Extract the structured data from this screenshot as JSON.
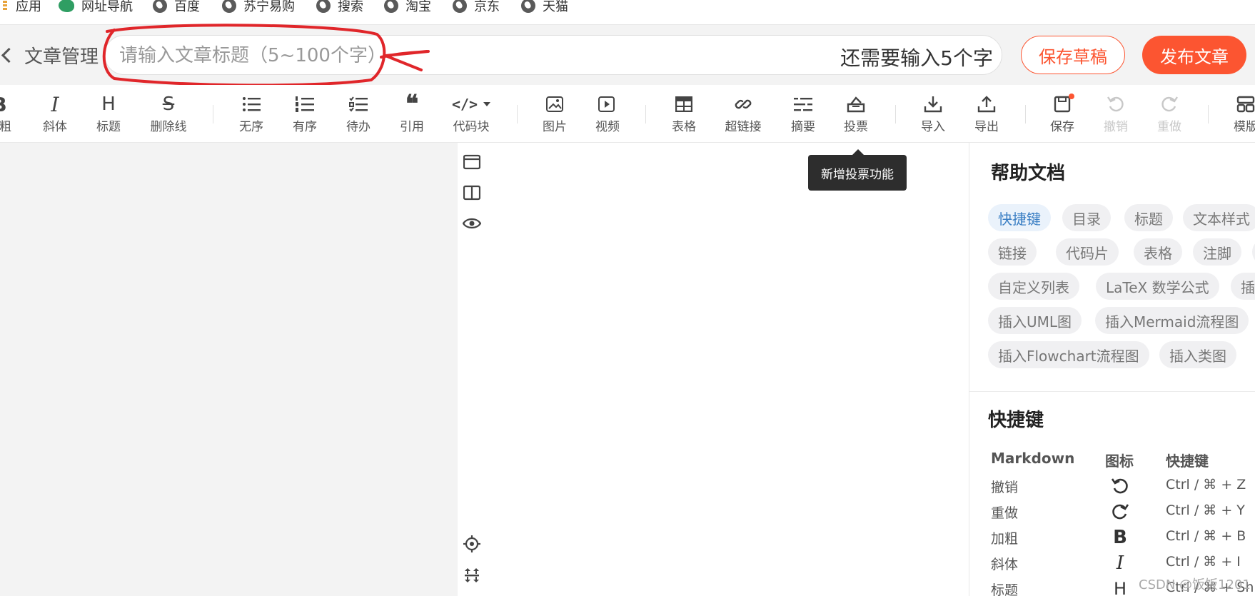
{
  "bookmarks": [
    {
      "label": "应用",
      "icon": "apps-icon"
    },
    {
      "label": "网址导航",
      "icon": "leaf-icon"
    },
    {
      "label": "百度",
      "icon": "globe-icon"
    },
    {
      "label": "苏宁易购",
      "icon": "globe-icon"
    },
    {
      "label": "搜索",
      "icon": "globe-icon"
    },
    {
      "label": "淘宝",
      "icon": "globe-icon"
    },
    {
      "label": "京东",
      "icon": "globe-icon"
    },
    {
      "label": "天猫",
      "icon": "globe-icon"
    }
  ],
  "header": {
    "back_label": "文章管理",
    "title_placeholder": "请输入文章标题（5~100个字）",
    "title_value": "",
    "remaining_hint": "还需要输入5个字",
    "save_draft_label": "保存草稿",
    "publish_label": "发布文章",
    "accent_color": "#fc5531"
  },
  "toolbar": {
    "items": [
      {
        "label": "加粗",
        "icon": "bold-icon"
      },
      {
        "label": "斜体",
        "icon": "italic-icon"
      },
      {
        "label": "标题",
        "icon": "heading-icon"
      },
      {
        "label": "删除线",
        "icon": "strikethrough-icon"
      },
      {
        "label": "无序",
        "icon": "unordered-list-icon"
      },
      {
        "label": "有序",
        "icon": "ordered-list-icon"
      },
      {
        "label": "待办",
        "icon": "todo-list-icon"
      },
      {
        "label": "引用",
        "icon": "quote-icon"
      },
      {
        "label": "代码块",
        "icon": "code-block-icon"
      },
      {
        "label": "图片",
        "icon": "image-icon"
      },
      {
        "label": "视频",
        "icon": "video-icon"
      },
      {
        "label": "表格",
        "icon": "table-icon"
      },
      {
        "label": "超链接",
        "icon": "link-icon"
      },
      {
        "label": "摘要",
        "icon": "summary-icon"
      },
      {
        "label": "投票",
        "icon": "vote-icon"
      },
      {
        "label": "导入",
        "icon": "import-icon"
      },
      {
        "label": "导出",
        "icon": "export-icon"
      },
      {
        "label": "保存",
        "icon": "save-icon"
      },
      {
        "label": "撤销",
        "icon": "undo-icon"
      },
      {
        "label": "重做",
        "icon": "redo-icon"
      },
      {
        "label": "模版",
        "icon": "template-icon"
      }
    ]
  },
  "tooltip": {
    "text": "新增投票功能"
  },
  "help": {
    "title": "帮助文档",
    "tags": [
      "快捷键",
      "目录",
      "标题",
      "文本样式",
      "链接",
      "代码片",
      "表格",
      "注脚",
      "注释",
      "自定义列表",
      "LaTeX 数学公式",
      "插入甘特图",
      "插入UML图",
      "插入Mermaid流程图",
      "插入Flowchart流程图",
      "插入类图"
    ],
    "shortcuts_title": "快捷键",
    "columns": [
      "Markdown",
      "图标",
      "快捷键"
    ],
    "rows": [
      {
        "name": "撤销",
        "icon": "undo-icon",
        "key": "Ctrl / ⌘ + Z"
      },
      {
        "name": "重做",
        "icon": "redo-icon",
        "key": "Ctrl / ⌘ + Y"
      },
      {
        "name": "加粗",
        "icon": "bold-icon",
        "key": "Ctrl / ⌘ + B"
      },
      {
        "name": "斜体",
        "icon": "italic-icon",
        "key": "Ctrl / ⌘ + I"
      },
      {
        "name": "标题",
        "icon": "heading-icon",
        "key": "Ctrl / ⌘ + Shift + H"
      }
    ]
  },
  "watermark": "CSDN @饭饭1201"
}
